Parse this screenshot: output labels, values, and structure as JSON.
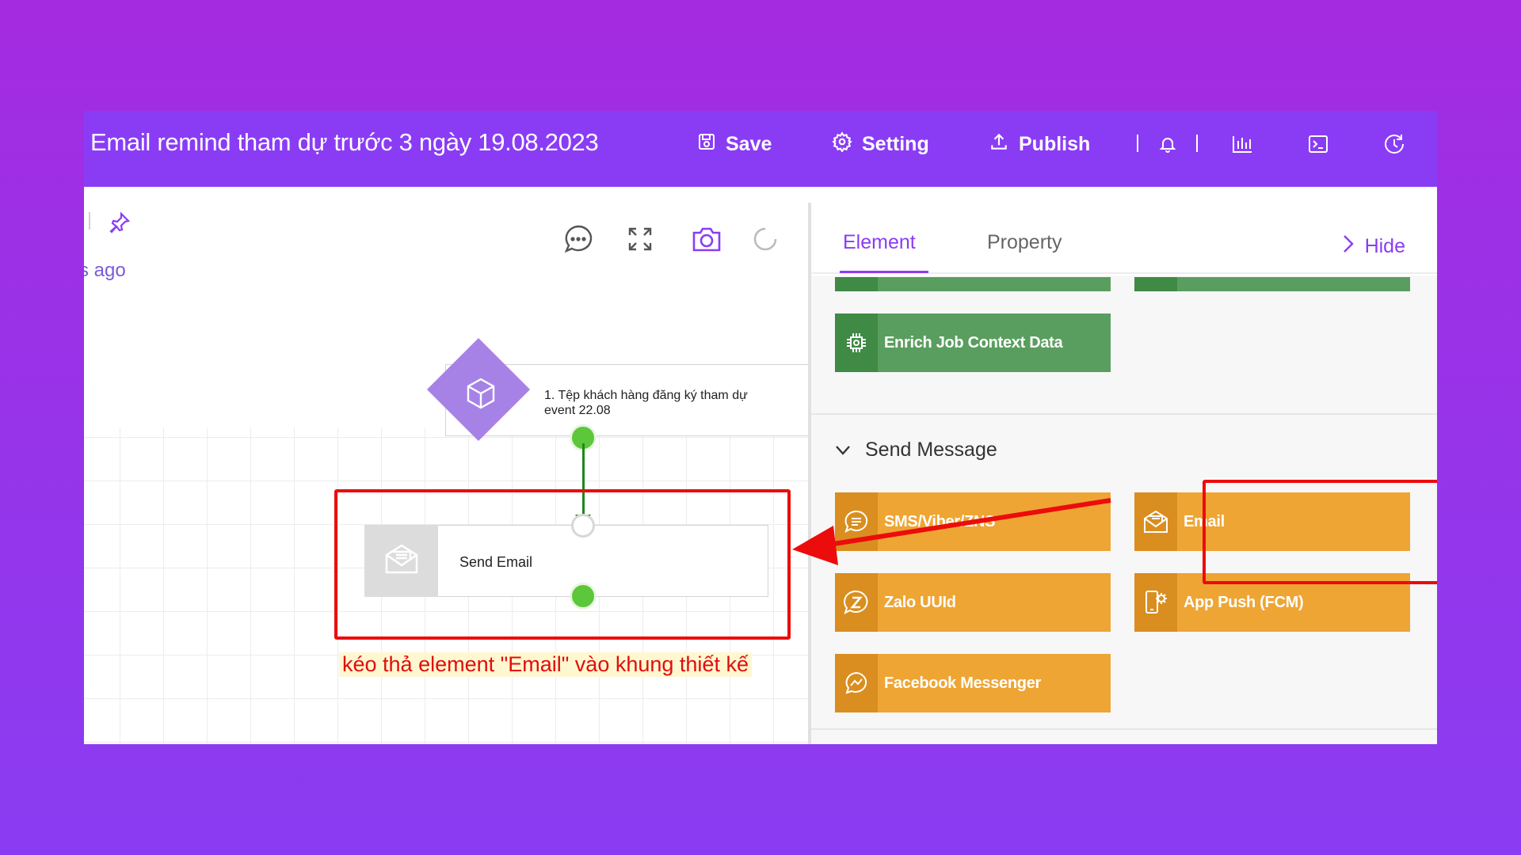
{
  "header": {
    "title": "Email remind tham dự trước 3 ngày 19.08.2023",
    "save_label": "Save",
    "setting_label": "Setting",
    "publish_label": "Publish",
    "icons": [
      "save-icon",
      "gear-icon",
      "upload-icon",
      "bell-icon",
      "bar-chart-icon",
      "terminal-icon",
      "history-icon"
    ]
  },
  "canvas": {
    "last_saved_fragment": "s ago",
    "tools": [
      "comment-icon",
      "fullscreen-icon",
      "camera-icon",
      "refresh-icon"
    ],
    "nodes": [
      {
        "label": "1. Tệp khách hàng đăng ký tham dự event 22.08",
        "icon": "cube-icon"
      },
      {
        "label": "Send Email",
        "icon": "envelope-icon"
      }
    ],
    "hint": "kéo thả element \"Email\" vào khung thiết kế"
  },
  "panel": {
    "tabs": [
      {
        "label": "Element",
        "active": true
      },
      {
        "label": "Property",
        "active": false
      }
    ],
    "hide_label": "Hide",
    "data_elements": [
      {
        "label": "Enrich Job Context Data",
        "icon": "chip-icon"
      }
    ],
    "send_message_section": {
      "title": "Send Message",
      "elements": [
        {
          "label": "SMS/Viber/ZNS",
          "icon": "chat-icon"
        },
        {
          "label": "Email",
          "icon": "envelope-icon"
        },
        {
          "label": "Zalo UUId",
          "icon": "zalo-icon"
        },
        {
          "label": "App Push (FCM)",
          "icon": "phone-gear-icon"
        },
        {
          "label": "Facebook Messenger",
          "icon": "messenger-icon"
        }
      ]
    }
  },
  "colors": {
    "background": "#a42be0",
    "topbar": "#8a3cf5",
    "accent": "#8a3cf5",
    "green_element": "#5a9e5f",
    "orange_element": "#eea534",
    "annotation_red": "#ec0c0c"
  }
}
